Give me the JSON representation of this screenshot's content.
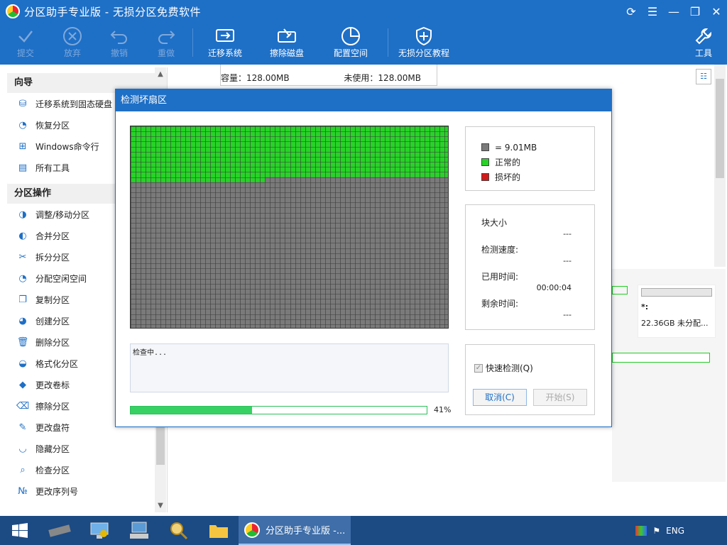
{
  "window": {
    "title": "分区助手专业版 - 无损分区免费软件",
    "controls": [
      "refresh-icon",
      "menu-icon",
      "minimize-icon",
      "restore-icon",
      "close-icon"
    ]
  },
  "toolbar": {
    "commit": "提交",
    "discard": "放弃",
    "undo": "撤销",
    "redo": "重做",
    "migrate": "迁移系统",
    "wipe": "擦除磁盘",
    "allocate": "配置空间",
    "tutorial": "无损分区教程",
    "tools": "工具"
  },
  "sidebar": {
    "wizard_title": "向导",
    "wizard_items": [
      {
        "label": "迁移系统到固态硬盘",
        "icon": "migrate-icon"
      },
      {
        "label": "恢复分区",
        "icon": "recover-icon"
      },
      {
        "label": "Windows命令行",
        "icon": "windows-icon"
      },
      {
        "label": "所有工具",
        "icon": "tools-icon"
      }
    ],
    "ops_title": "分区操作",
    "ops_items": [
      {
        "label": "调整/移动分区",
        "icon": "resize-icon"
      },
      {
        "label": "合并分区",
        "icon": "merge-icon"
      },
      {
        "label": "拆分分区",
        "icon": "split-icon"
      },
      {
        "label": "分配空闲空间",
        "icon": "allocate-icon"
      },
      {
        "label": "复制分区",
        "icon": "copy-icon"
      },
      {
        "label": "创建分区",
        "icon": "create-icon"
      },
      {
        "label": "删除分区",
        "icon": "delete-icon"
      },
      {
        "label": "格式化分区",
        "icon": "format-icon"
      },
      {
        "label": "更改卷标",
        "icon": "label-icon"
      },
      {
        "label": "擦除分区",
        "icon": "wipe-icon"
      },
      {
        "label": "更改盘符",
        "icon": "letter-icon"
      },
      {
        "label": "隐藏分区",
        "icon": "hide-icon"
      },
      {
        "label": "检查分区",
        "icon": "check-icon"
      },
      {
        "label": "更改序列号",
        "icon": "serial-icon"
      }
    ]
  },
  "main": {
    "capacity": "容量：128.00MB",
    "unused": "未使用：128.00MB",
    "partition_label": "*:",
    "partition_info": "22.36GB 未分配..."
  },
  "dialog": {
    "title": "检测坏扇区",
    "legend": {
      "block": "= 9.01MB",
      "normal": "正常的",
      "bad": "损坏的"
    },
    "colors": {
      "block": "#7a7a7a",
      "normal": "#27d327",
      "bad": "#d21a1a"
    },
    "scan": {
      "cols": 64,
      "rows": 40,
      "checked_blocks": 667
    },
    "info": {
      "block_size_label": "块大小",
      "block_size_value": "---",
      "speed_label": "检测速度:",
      "speed_value": "---",
      "elapsed_label": "已用时间:",
      "elapsed_value": "00:00:04",
      "remaining_label": "剩余时间:",
      "remaining_value": "---"
    },
    "log_text": "检查中...",
    "progress_percent": 41,
    "progress_text": "41%",
    "quick_check": "快速检测(Q)",
    "cancel": "取消(C)",
    "start": "开始(S)"
  },
  "taskbar": {
    "active_app": "分区助手专业版 -...",
    "tray_lang": "ENG"
  }
}
